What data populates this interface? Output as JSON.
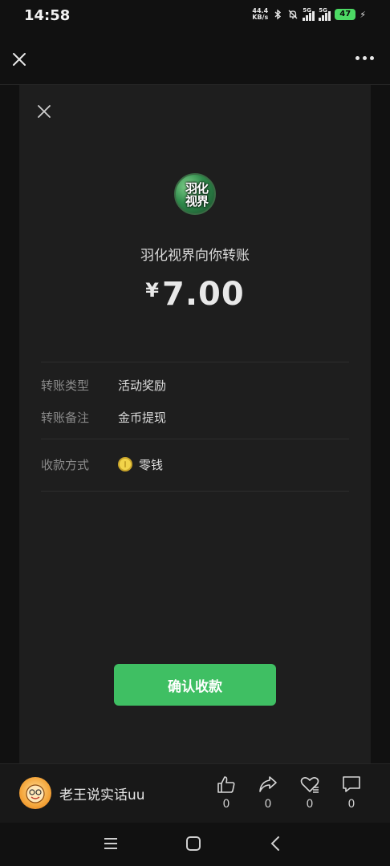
{
  "status_bar": {
    "time": "14:58",
    "net_speed_value": "44.4",
    "net_speed_unit": "KB/s",
    "signal1_label": "5G",
    "signal2_label": "5G",
    "battery": "47",
    "icons": [
      "bluetooth-icon",
      "mute-bell-icon",
      "signal-icon",
      "battery-icon",
      "charging-icon"
    ]
  },
  "top_nav": {
    "icons": [
      "close-icon",
      "more-icon"
    ]
  },
  "transfer": {
    "avatar_text_line1": "羽化",
    "avatar_text_line2": "视界",
    "title": "羽化视界向你转账",
    "currency": "¥",
    "amount": "7.00",
    "details": [
      {
        "label": "转账类型",
        "value": "活动奖励"
      },
      {
        "label": "转账备注",
        "value": "金币提现"
      }
    ],
    "payment_method_label": "收款方式",
    "payment_method_value": "零钱",
    "confirm_label": "确认收款"
  },
  "bottom_bar": {
    "author_name": "老王说实话uu",
    "actions": [
      {
        "name": "like",
        "icon": "thumbs-up-icon",
        "count": "0"
      },
      {
        "name": "share",
        "icon": "share-icon",
        "count": "0"
      },
      {
        "name": "favorite",
        "icon": "heart-icon",
        "count": "0"
      },
      {
        "name": "comment",
        "icon": "comment-icon",
        "count": "0"
      }
    ]
  },
  "colors": {
    "background": "#111111",
    "card": "#1e1e1e",
    "accent_green": "#3fbf63",
    "battery_green": "#4cd964",
    "coin_yellow": "#f2d34a"
  }
}
